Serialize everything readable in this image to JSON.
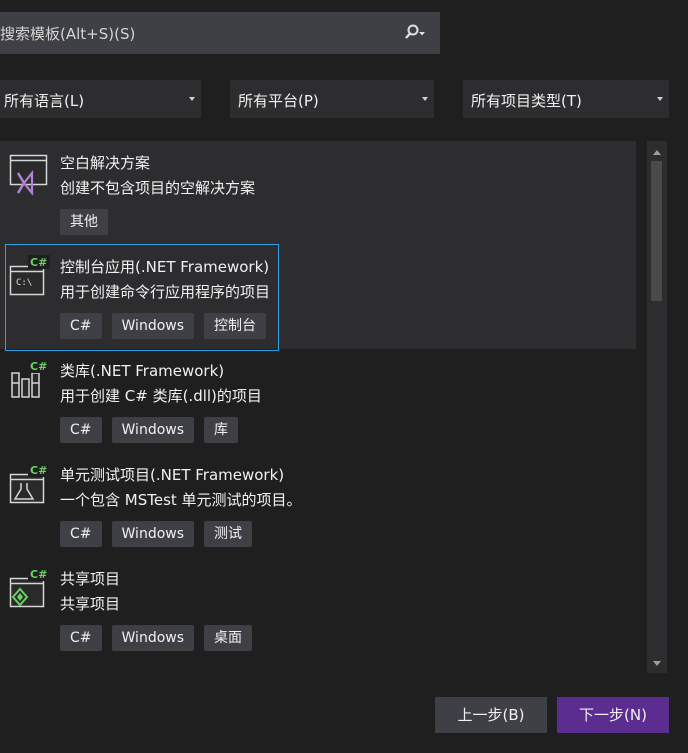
{
  "search": {
    "placeholder": "搜索模板(Alt+S)(S)"
  },
  "filters": {
    "language": "所有语言(L)",
    "platform": "所有平台(P)",
    "project_type": "所有项目类型(T)"
  },
  "templates": [
    {
      "title": "空白解决方案",
      "description": "创建不包含项目的空解决方案",
      "tags": [
        "其他"
      ],
      "icon": "blank-solution-icon"
    },
    {
      "title": "控制台应用(.NET Framework)",
      "description": "用于创建命令行应用程序的项目",
      "tags": [
        "C#",
        "Windows",
        "控制台"
      ],
      "icon": "console-app-icon"
    },
    {
      "title": "类库(.NET Framework)",
      "description": "用于创建 C# 类库(.dll)的项目",
      "tags": [
        "C#",
        "Windows",
        "库"
      ],
      "icon": "class-library-icon"
    },
    {
      "title": "单元测试项目(.NET Framework)",
      "description": "一个包含 MSTest 单元测试的项目。",
      "tags": [
        "C#",
        "Windows",
        "测试"
      ],
      "icon": "unit-test-icon"
    },
    {
      "title": "共享项目",
      "description": "共享项目",
      "tags": [
        "C#",
        "Windows",
        "桌面"
      ],
      "icon": "shared-project-icon"
    }
  ],
  "footer": {
    "back_label": "上一步(B)",
    "next_label": "下一步(N)"
  },
  "colors": {
    "background": "#1f1f1f",
    "accent": "#5c2d91",
    "selection": "#2ea0e6",
    "csharp": "#68d161"
  }
}
